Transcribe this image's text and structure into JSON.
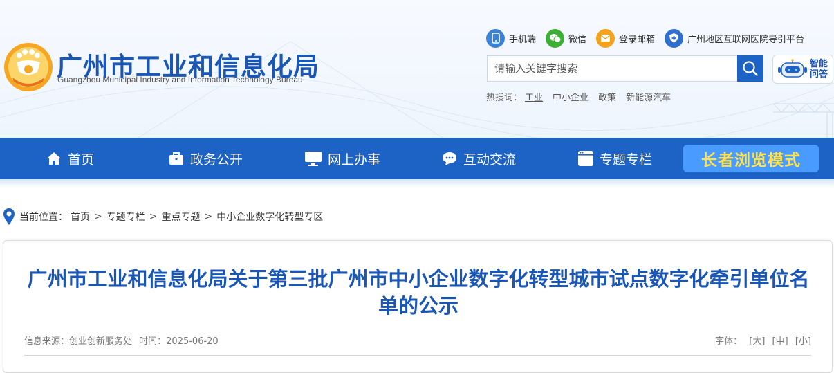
{
  "header": {
    "title_cn": "广州市工业和信息化局",
    "title_en": "Guangzhou Municipal Industry and Information Technology Bureau",
    "toplinks": [
      {
        "label": "手机端",
        "icon": "mobile-icon"
      },
      {
        "label": "微信",
        "icon": "wechat-icon"
      },
      {
        "label": "登录邮箱",
        "icon": "mail-icon"
      },
      {
        "label": "广州地区互联网医院导引平台",
        "icon": "hospital-shield-icon"
      }
    ],
    "search": {
      "placeholder": "请输入关键字搜索"
    },
    "ai": {
      "label_line1": "智能",
      "label_line2": "问答"
    },
    "hotwords": {
      "label": "热搜词：",
      "items": [
        "工业",
        "中小企业",
        "政策",
        "新能源汽车"
      ]
    }
  },
  "nav": {
    "items": [
      {
        "label": "首页",
        "icon": "home-icon"
      },
      {
        "label": "政务公开",
        "icon": "briefcase-icon"
      },
      {
        "label": "网上办事",
        "icon": "monitor-icon"
      },
      {
        "label": "互动交流",
        "icon": "chat-icon"
      },
      {
        "label": "专题专栏",
        "icon": "window-icon"
      }
    ],
    "elder_mode": "长者浏览模式"
  },
  "breadcrumb": {
    "label": "当前位置：",
    "items": [
      "首页",
      "专题专栏",
      "重点专题",
      "中小企业数字化转型专区"
    ],
    "separator": ">"
  },
  "article": {
    "title": "广州市工业和信息化局关于第三批广州市中小企业数字化转型城市试点数字化牵引单位名单的公示",
    "source_label": "信息来源：创业创新服务处",
    "time_label": "时间：2025-06-20",
    "fontsize": {
      "label": "字体：",
      "large": "[大]",
      "medium": "[中]",
      "small": "[小]"
    }
  },
  "colors": {
    "brand_blue": "#1d63c5",
    "title_blue": "#1a56b5",
    "elder_bg": "#4a9bff",
    "elder_text": "#ffe14a"
  }
}
